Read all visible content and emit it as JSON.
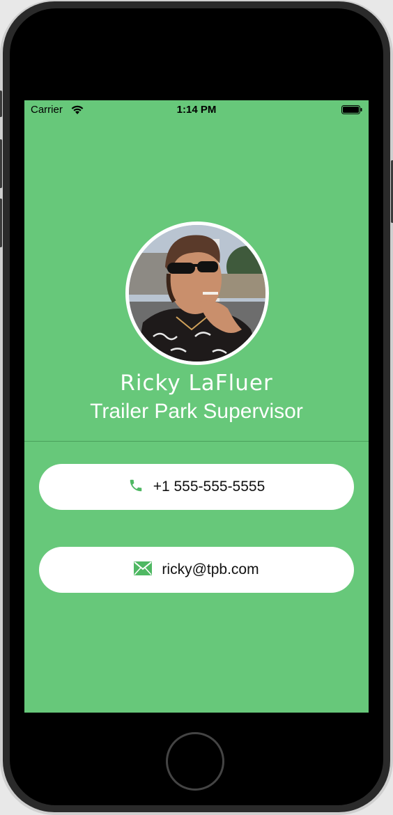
{
  "status_bar": {
    "carrier": "Carrier",
    "time": "1:14 PM",
    "wifi_icon": "wifi-icon",
    "battery_icon": "battery-icon"
  },
  "profile": {
    "avatar_icon": "profile-photo",
    "name": "Ricky LaFluer",
    "job_title": "Trailer Park Supervisor"
  },
  "contact": {
    "phone": {
      "icon": "phone-icon",
      "text": "+1 555-555-5555"
    },
    "email": {
      "icon": "envelope-icon",
      "text": "ricky@tpb.com"
    }
  },
  "colors": {
    "background": "#67c87a",
    "accent": "#4fb863",
    "pill": "#ffffff",
    "text_on_green": "#ffffff"
  }
}
